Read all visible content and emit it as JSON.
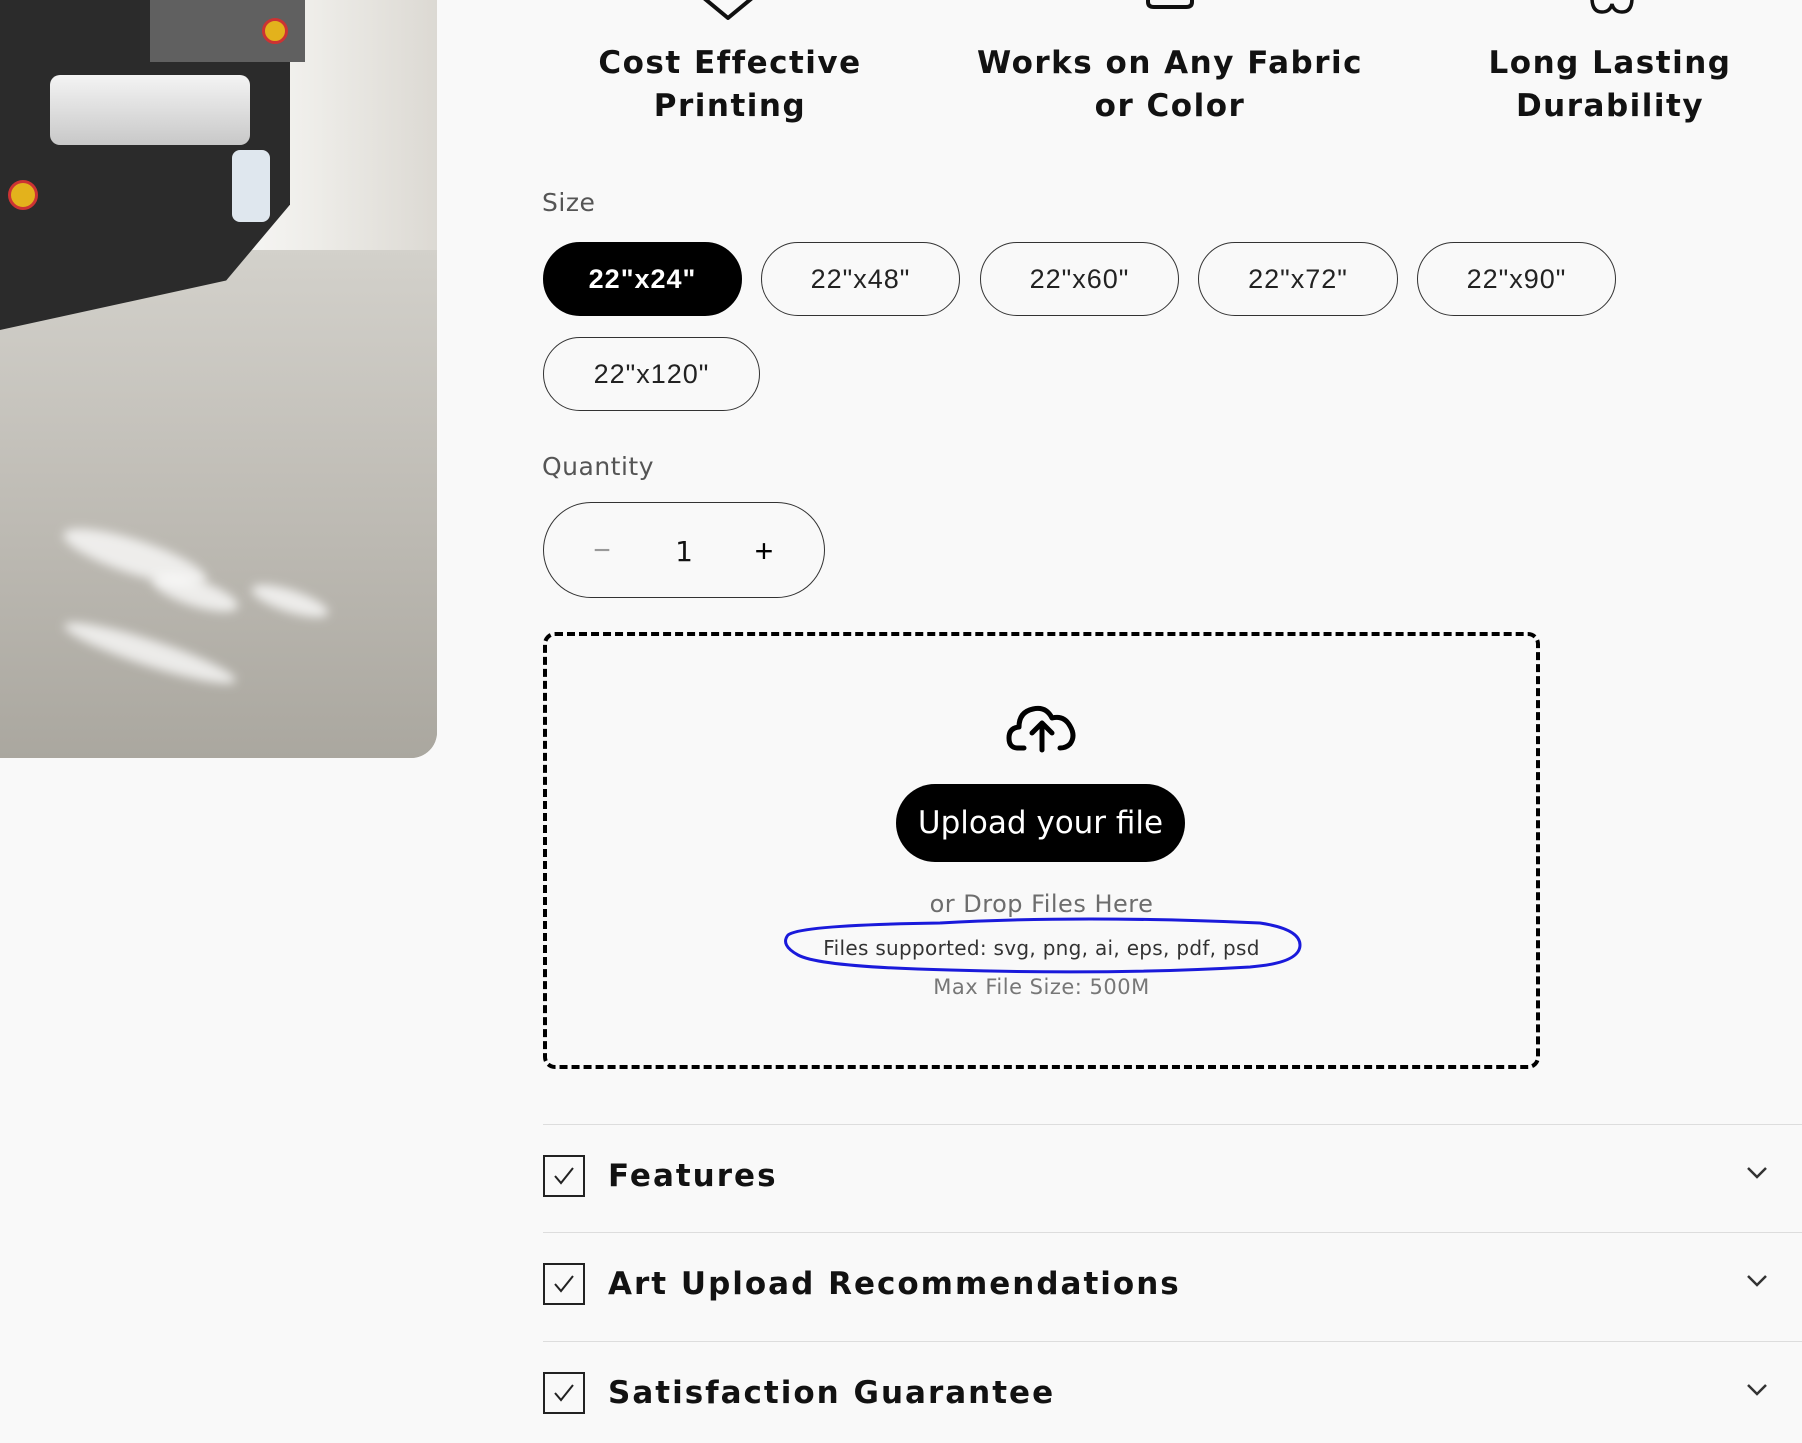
{
  "features": [
    {
      "line1": "Cost Effective",
      "line2": "Printing",
      "icon": "tag-icon"
    },
    {
      "line1": "Works on Any Fabric",
      "line2": "or Color",
      "icon": "shirt-icon"
    },
    {
      "line1": "Long Lasting",
      "line2": "Durability",
      "icon": "infinity-icon"
    }
  ],
  "size": {
    "label": "Size",
    "options": [
      "22\"x24\"",
      "22\"x48\"",
      "22\"x60\"",
      "22\"x72\"",
      "22\"x90\"",
      "22\"x120\""
    ],
    "selected": "22\"x24\""
  },
  "quantity": {
    "label": "Quantity",
    "minus": "−",
    "value": "1",
    "plus": "+"
  },
  "upload": {
    "button_label": "Upload your file",
    "drop_text": "or Drop Files Here",
    "supported_text": "Files supported: svg, png, ai, eps, pdf, psd",
    "max_size_text": "Max File Size: 500M",
    "annotation_color": "#1a1adb"
  },
  "accordions": [
    {
      "title": "Features"
    },
    {
      "title": "Art Upload Recommendations"
    },
    {
      "title": "Satisfaction Guarantee"
    }
  ],
  "colors": {
    "selected_bg": "#000000",
    "page_bg": "#f9f9f9"
  }
}
